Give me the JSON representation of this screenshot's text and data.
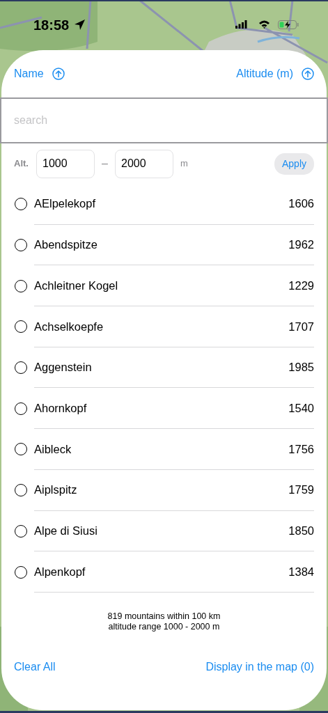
{
  "status_bar": {
    "time": "18:58"
  },
  "sort_headers": [
    {
      "label": "Name"
    },
    {
      "label": "Altitude (m)"
    }
  ],
  "search": {
    "placeholder": "search"
  },
  "altitude_filter": {
    "label": "Alt.",
    "min": "1000",
    "separator": "–",
    "max": "2000",
    "unit": "m",
    "apply": "Apply"
  },
  "mountains": [
    {
      "name": "AElpelekopf",
      "altitude": "1606",
      "selected": false
    },
    {
      "name": "Abendspitze",
      "altitude": "1962",
      "selected": false
    },
    {
      "name": "Achleitner Kogel",
      "altitude": "1229",
      "selected": false
    },
    {
      "name": "Achselkoepfe",
      "altitude": "1707",
      "selected": false
    },
    {
      "name": "Aggenstein",
      "altitude": "1985",
      "selected": false
    },
    {
      "name": "Ahornkopf",
      "altitude": "1540",
      "selected": false
    },
    {
      "name": "Aibleck",
      "altitude": "1756",
      "selected": false
    },
    {
      "name": "Aiplspitz",
      "altitude": "1759",
      "selected": false
    },
    {
      "name": "Alpe di Siusi",
      "altitude": "1850",
      "selected": false
    },
    {
      "name": "Alpenkopf",
      "altitude": "1384",
      "selected": false
    }
  ],
  "summary": [
    "819 mountains within 100 km",
    "altitude range 1000 - 2000 m"
  ],
  "footer_buttons": [
    {
      "label": "Clear All"
    },
    {
      "label": "Display in the map (0)"
    }
  ]
}
